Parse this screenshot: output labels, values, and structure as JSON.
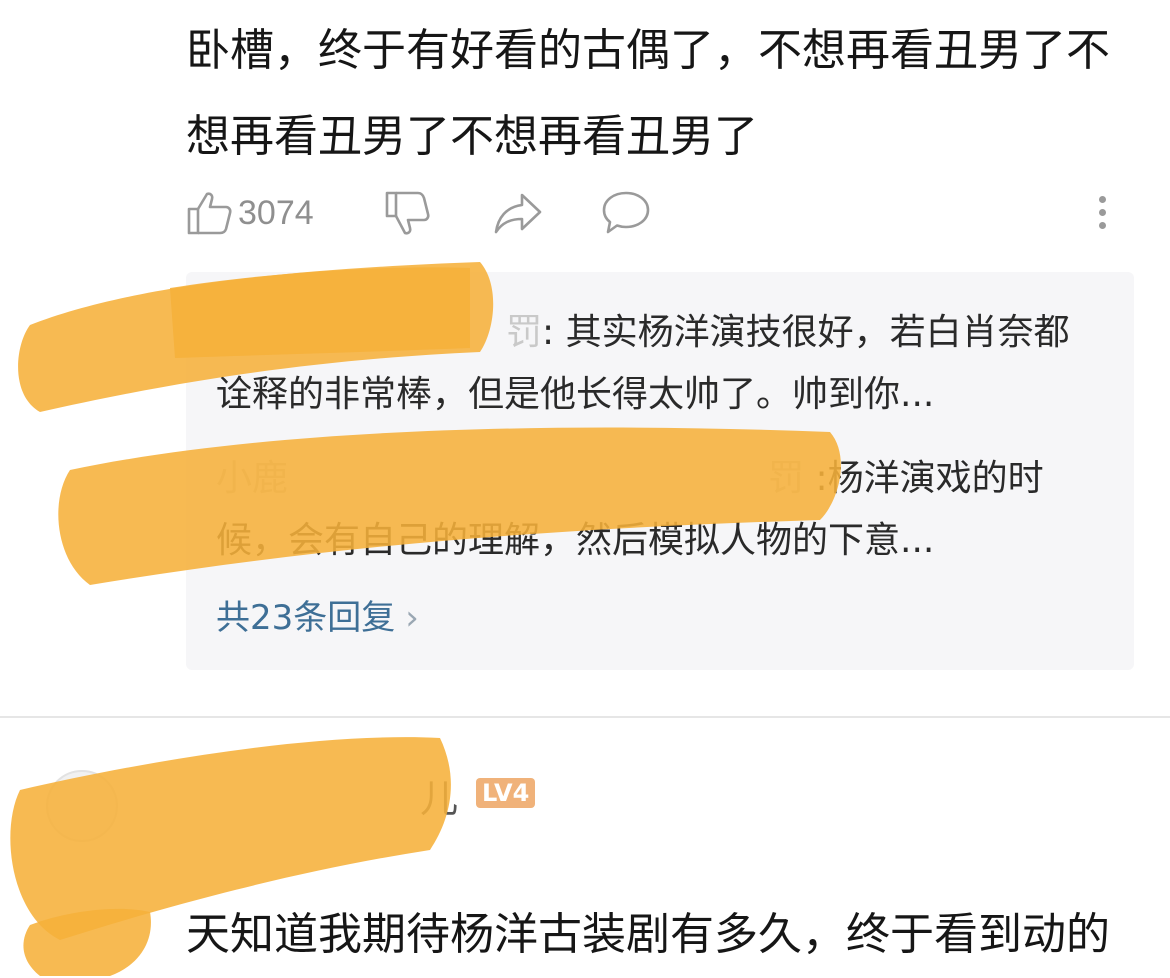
{
  "comment1": {
    "text": "卧槽，终于有好看的古偶了，不想再看丑男了不想再看丑男了不想再看丑男了",
    "actions": {
      "like_count": "3074",
      "like_icon": "thumbs-up-icon",
      "dislike_icon": "thumbs-down-icon",
      "share_icon": "share-icon",
      "reply_icon": "comment-bubble-icon",
      "more_icon": "more-vertical-icon"
    },
    "replies": [
      {
        "author_tail": "罚",
        "text": ": 其实杨洋演技很好，若白肖奈都诠释的非常棒，但是他长得太帅了。帅到你..."
      },
      {
        "author_head": "小鹿",
        "author_tail": "罚",
        "text": " :杨洋演戏的时候，会有自己的理解，然后模拟人物的下意..."
      }
    ],
    "replies_link": "共23条回复",
    "replies_chevron": "›"
  },
  "comment2": {
    "username_tail": "儿",
    "level": "LV4",
    "text": "天知道我期待杨洋古装剧有多久，终于看到动的"
  },
  "colors": {
    "link": "#3e6f96",
    "redaction": "#f6b13a",
    "level_badge": "#f0b27a",
    "reply_bg": "#f6f6f8"
  }
}
